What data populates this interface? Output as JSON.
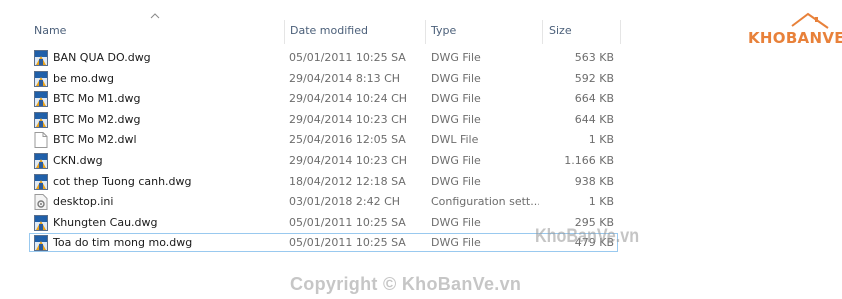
{
  "columns": {
    "name": "Name",
    "date": "Date modified",
    "type": "Type",
    "size": "Size"
  },
  "files": [
    {
      "name": "BAN QUA DO.dwg",
      "date": "05/01/2011 10:25 SA",
      "type": "DWG File",
      "size": "563 KB",
      "icon": "dwg-file-icon"
    },
    {
      "name": "be mo.dwg",
      "date": "29/04/2014 8:13 CH",
      "type": "DWG File",
      "size": "592 KB",
      "icon": "dwg-file-icon"
    },
    {
      "name": "BTC Mo M1.dwg",
      "date": "29/04/2014 10:24 CH",
      "type": "DWG File",
      "size": "664 KB",
      "icon": "dwg-file-icon"
    },
    {
      "name": "BTC Mo M2.dwg",
      "date": "29/04/2014 10:23 CH",
      "type": "DWG File",
      "size": "644 KB",
      "icon": "dwg-file-icon"
    },
    {
      "name": "BTC Mo M2.dwl",
      "date": "25/04/2016 12:05 SA",
      "type": "DWL File",
      "size": "1 KB",
      "icon": "blank-file-icon"
    },
    {
      "name": "CKN.dwg",
      "date": "29/04/2014 10:23 CH",
      "type": "DWG File",
      "size": "1.166 KB",
      "icon": "dwg-file-icon"
    },
    {
      "name": "cot thep Tuong canh.dwg",
      "date": "18/04/2012 12:18 SA",
      "type": "DWG File",
      "size": "938 KB",
      "icon": "dwg-file-icon"
    },
    {
      "name": "desktop.ini",
      "date": "03/01/2018 2:42 CH",
      "type": "Configuration sett...",
      "size": "1 KB",
      "icon": "settings-file-icon"
    },
    {
      "name": "Khungten Cau.dwg",
      "date": "05/01/2011 10:25 SA",
      "type": "DWG File",
      "size": "295 KB",
      "icon": "dwg-file-icon"
    },
    {
      "name": "Toa do tim mong mo.dwg",
      "date": "05/01/2011 10:25 SA",
      "type": "DWG File",
      "size": "479 KB",
      "icon": "dwg-file-icon"
    }
  ],
  "logo": {
    "text": "KHOBANVE"
  },
  "watermarks": {
    "middle": "KhoBanVe.vn",
    "bottom": "Copyright © KhoBanVe.vn"
  },
  "colors": {
    "header_text": "#4c607a",
    "selection_border": "#99c9ef",
    "logo_orange": "#e8813a"
  }
}
